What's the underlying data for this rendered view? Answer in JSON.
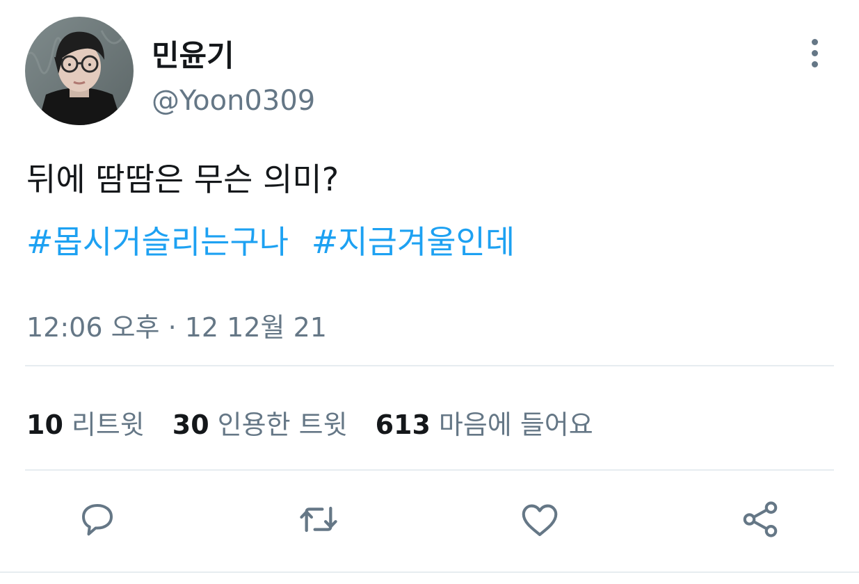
{
  "tweet": {
    "display_name": "민윤기",
    "handle": "@Yoon0309",
    "text": "뒤에 땀땀은 무슨 의미?",
    "hashtags": [
      "#몹시거슬리는구나",
      "#지금겨울인데"
    ],
    "timestamp": "12:06 오후 · 12 12월 21"
  },
  "stats": {
    "retweets_count": "10",
    "retweets_label": "리트윗",
    "quotes_count": "30",
    "quotes_label": "인용한 트윗",
    "likes_count": "613",
    "likes_label": "마음에 들어요"
  },
  "icons": {
    "more": "more-vertical-icon",
    "reply": "reply-icon",
    "retweet": "retweet-icon",
    "like": "heart-icon",
    "share": "share-icon"
  },
  "colors": {
    "text_primary": "#14171a",
    "text_secondary": "#657786",
    "link": "#1da1f2",
    "divider": "#e6ecf0"
  }
}
